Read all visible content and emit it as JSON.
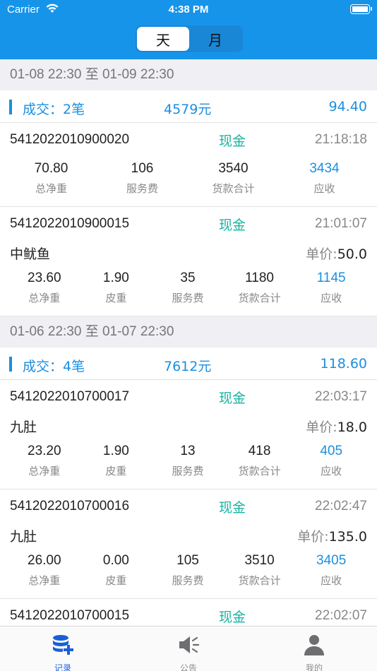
{
  "status_bar": {
    "carrier": "Carrier",
    "time": "4:38 PM"
  },
  "segment": {
    "options": [
      "天",
      "月"
    ],
    "selected": "天"
  },
  "groups": [
    {
      "date_range": "01-08 22:30 至 01-09 22:30",
      "summary": {
        "count": "成交：2笔",
        "amount": "4579元",
        "weight": "94.40"
      },
      "records": [
        {
          "id": "5412022010900020",
          "method": "现金",
          "time": "21:18:18",
          "stats": [
            {
              "value": "70.80",
              "label": "总净重"
            },
            {
              "value": "106",
              "label": "服务费"
            },
            {
              "value": "3540",
              "label": "货款合计"
            },
            {
              "value": "3434",
              "label": "应收"
            }
          ]
        },
        {
          "id": "5412022010900015",
          "method": "现金",
          "time": "21:01:07",
          "name": "中鱿鱼",
          "price_label": "单价:",
          "price": "50.0",
          "stats": [
            {
              "value": "23.60",
              "label": "总净重"
            },
            {
              "value": "1.90",
              "label": "皮重"
            },
            {
              "value": "35",
              "label": "服务费"
            },
            {
              "value": "1180",
              "label": "货款合计"
            },
            {
              "value": "1145",
              "label": "应收"
            }
          ]
        }
      ]
    },
    {
      "date_range": "01-06 22:30 至 01-07 22:30",
      "summary": {
        "count": "成交：4笔",
        "amount": "7612元",
        "weight": "118.60"
      },
      "records": [
        {
          "id": "5412022010700017",
          "method": "现金",
          "time": "22:03:17",
          "name": "九肚",
          "price_label": "单价:",
          "price": "18.0",
          "stats": [
            {
              "value": "23.20",
              "label": "总净重"
            },
            {
              "value": "1.90",
              "label": "皮重"
            },
            {
              "value": "13",
              "label": "服务费"
            },
            {
              "value": "418",
              "label": "货款合计"
            },
            {
              "value": "405",
              "label": "应收"
            }
          ]
        },
        {
          "id": "5412022010700016",
          "method": "现金",
          "time": "22:02:47",
          "name": "九肚",
          "price_label": "单价:",
          "price": "135.0",
          "stats": [
            {
              "value": "26.00",
              "label": "总净重"
            },
            {
              "value": "0.00",
              "label": "皮重"
            },
            {
              "value": "105",
              "label": "服务费"
            },
            {
              "value": "3510",
              "label": "货款合计"
            },
            {
              "value": "3405",
              "label": "应收"
            }
          ]
        },
        {
          "id": "5412022010700015",
          "method": "现金",
          "time": "22:02:07"
        }
      ]
    }
  ],
  "tabbar": {
    "items": [
      {
        "label": "记录",
        "icon": "database-add-icon",
        "active": true
      },
      {
        "label": "公告",
        "icon": "speaker-icon",
        "active": false
      },
      {
        "label": "我的",
        "icon": "person-icon",
        "active": false
      }
    ]
  },
  "colors": {
    "header": "#1694ea",
    "accent_blue": "#1a8fe0",
    "method_green": "#19b3a0",
    "tab_active": "#1a5fd8"
  }
}
